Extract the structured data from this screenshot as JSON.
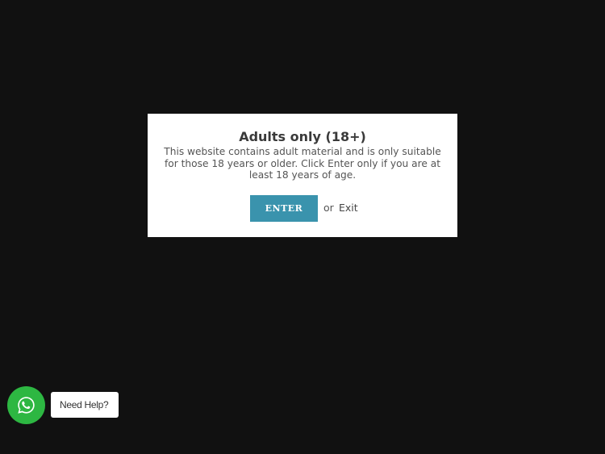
{
  "age_gate": {
    "title": "Adults only (18+)",
    "message": "This website contains adult material and is only suitable for those 18 years or older. Click Enter only if you are at least 18 years of age.",
    "enter_label": "ENTER",
    "or_label": "or",
    "exit_label": "Exit"
  },
  "chat_widget": {
    "icon": "whatsapp-icon",
    "label": "Need Help?"
  },
  "colors": {
    "background": "#111111",
    "modal_background": "#ffffff",
    "enter_button": "#3a93ad",
    "whatsapp_green": "#2db742"
  }
}
